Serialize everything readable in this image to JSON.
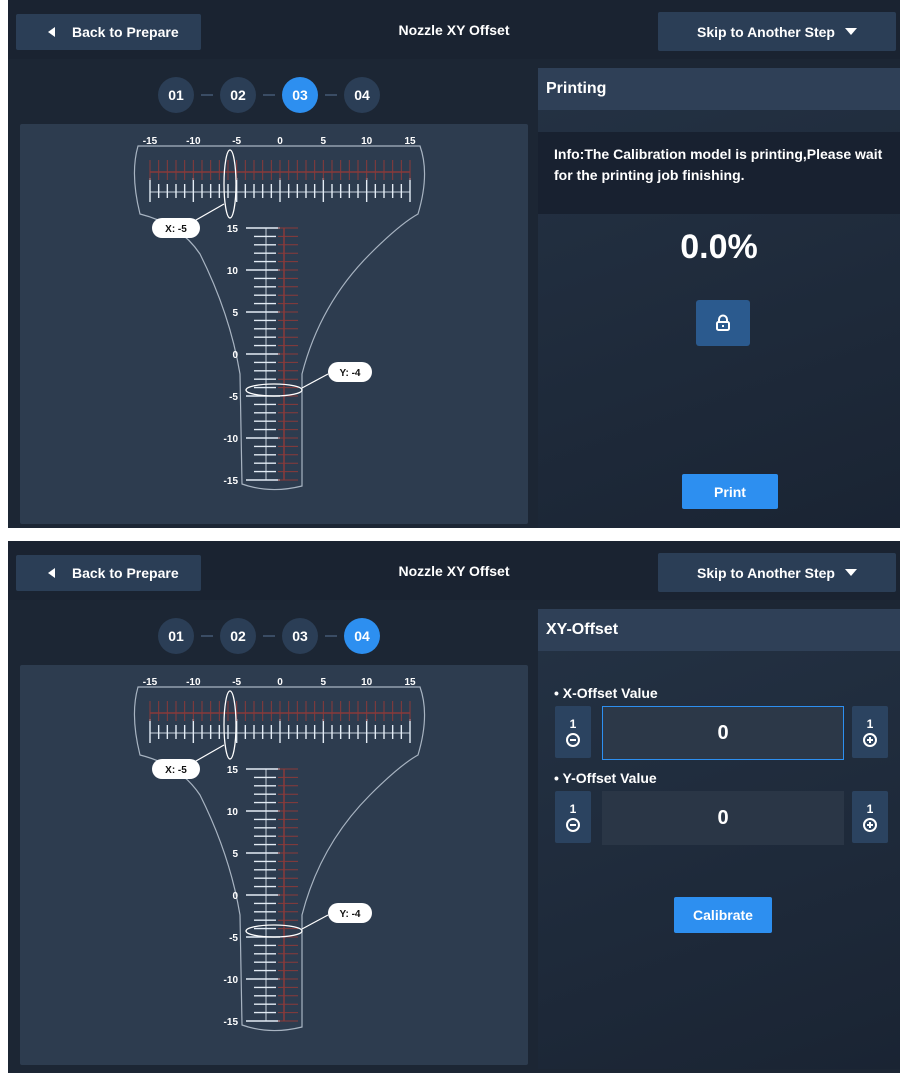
{
  "common": {
    "back_label": "Back to Prepare",
    "title": "Nozzle XY Offset",
    "skip_label": "Skip to Another Step",
    "steps": [
      "01",
      "02",
      "03",
      "04"
    ],
    "guide": {
      "x_ticks": [
        "-15",
        "-10",
        "-5",
        "0",
        "5",
        "10",
        "15"
      ],
      "y_ticks": [
        "15",
        "10",
        "5",
        "0",
        "-5",
        "-10",
        "-15"
      ],
      "x_callout": "X: -5",
      "y_callout": "Y: -4"
    },
    "colors": {
      "accent": "#2d8ff0",
      "panel": "#2d3c4f",
      "bg": "#1c2634"
    }
  },
  "screen1": {
    "active_step": "03",
    "panel_title": "Printing",
    "info_text": "Info:The Calibration model is printing,Please wait for the printing job finishing.",
    "progress": "0.0%",
    "lock_icon": "lock-icon",
    "print_label": "Print"
  },
  "screen2": {
    "active_step": "04",
    "panel_title": "XY-Offset",
    "x_label": "• X-Offset Value",
    "y_label": "• Y-Offset Value",
    "step_value": "1",
    "x_value": "0",
    "y_value": "0",
    "calibrate_label": "Calibrate"
  }
}
